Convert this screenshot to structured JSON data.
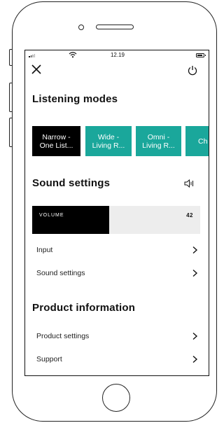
{
  "status_bar": {
    "time": "12.19"
  },
  "header": {
    "close_icon": "close-icon",
    "power_icon": "power-icon"
  },
  "listening_modes": {
    "title": "Listening modes",
    "modes": [
      {
        "line1": "Narrow -",
        "line2": "One List...",
        "selected": true,
        "color": "#000000"
      },
      {
        "line1": "Wide -",
        "line2": "Living R...",
        "selected": false,
        "color": "#1aa79b"
      },
      {
        "line1": "Omni -",
        "line2": "Living R...",
        "selected": false,
        "color": "#1aa79b"
      },
      {
        "line1": "Ch",
        "line2": "",
        "selected": false,
        "color": "#1aa79b"
      }
    ]
  },
  "sound_settings": {
    "title": "Sound settings",
    "icon": "speaker-icon",
    "volume": {
      "label": "VOLUME",
      "value": "42",
      "fill_fraction": 0.46
    },
    "rows": [
      {
        "label": "Input"
      },
      {
        "label": "Sound settings"
      }
    ]
  },
  "product_information": {
    "title": "Product information",
    "rows": [
      {
        "label": "Product settings"
      },
      {
        "label": "Support"
      }
    ]
  },
  "colors": {
    "accent": "#1aa79b",
    "selected": "#000000",
    "track": "#ededed"
  }
}
